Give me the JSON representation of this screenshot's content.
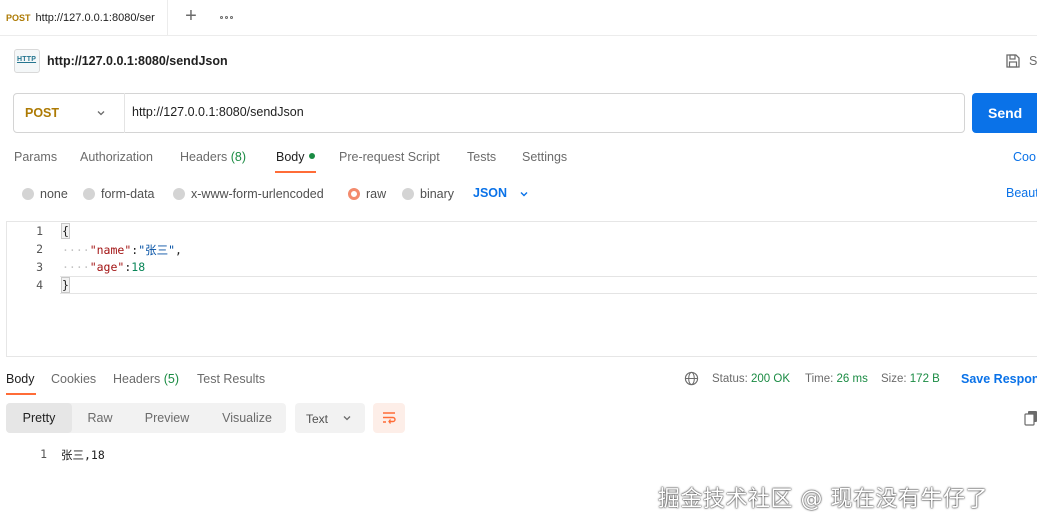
{
  "tab": {
    "method": "POST",
    "url": "http://127.0.0.1:8080/ser"
  },
  "request": {
    "icon_text": "HTTP",
    "title": "http://127.0.0.1:8080/sendJson",
    "save_label": "S",
    "method": "POST",
    "url": "http://127.0.0.1:8080/sendJson",
    "send_label": "Send"
  },
  "request_tabs": {
    "params": "Params",
    "authorization": "Authorization",
    "headers": "Headers",
    "headers_count": "(8)",
    "body": "Body",
    "pre_request": "Pre-request Script",
    "tests": "Tests",
    "settings": "Settings",
    "cookies": "Coo"
  },
  "body_types": {
    "none": "none",
    "form_data": "form-data",
    "urlencoded": "x-www-form-urlencoded",
    "raw": "raw",
    "binary": "binary",
    "language": "JSON",
    "beautify": "Beaut"
  },
  "editor": {
    "line_numbers": [
      "1",
      "2",
      "3",
      "4"
    ],
    "open_brace": "{",
    "indent": "····",
    "key1": "\"name\"",
    "colon": ":",
    "val1": "\"张三\"",
    "comma": ",",
    "key2": "\"age\"",
    "val2": "18",
    "close_brace": "}"
  },
  "response_tabs": {
    "body": "Body",
    "cookies": "Cookies",
    "headers": "Headers",
    "headers_count": "(5)",
    "test_results": "Test Results"
  },
  "response_status": {
    "status_label": "Status:",
    "status_value": "200 OK",
    "time_label": "Time:",
    "time_value": "26 ms",
    "size_label": "Size:",
    "size_value": "172 B",
    "save_response": "Save Respon"
  },
  "response_view": {
    "pretty": "Pretty",
    "raw": "Raw",
    "preview": "Preview",
    "visualize": "Visualize",
    "format": "Text"
  },
  "response_body": {
    "line": "1",
    "text": "张三,18"
  },
  "watermark": "掘金技术社区 @ 现在没有牛仔了",
  "colors": {
    "accent": "#ff6c37",
    "primary": "#0a72e8",
    "post": "#ad7a03",
    "success": "#1a8b43"
  }
}
